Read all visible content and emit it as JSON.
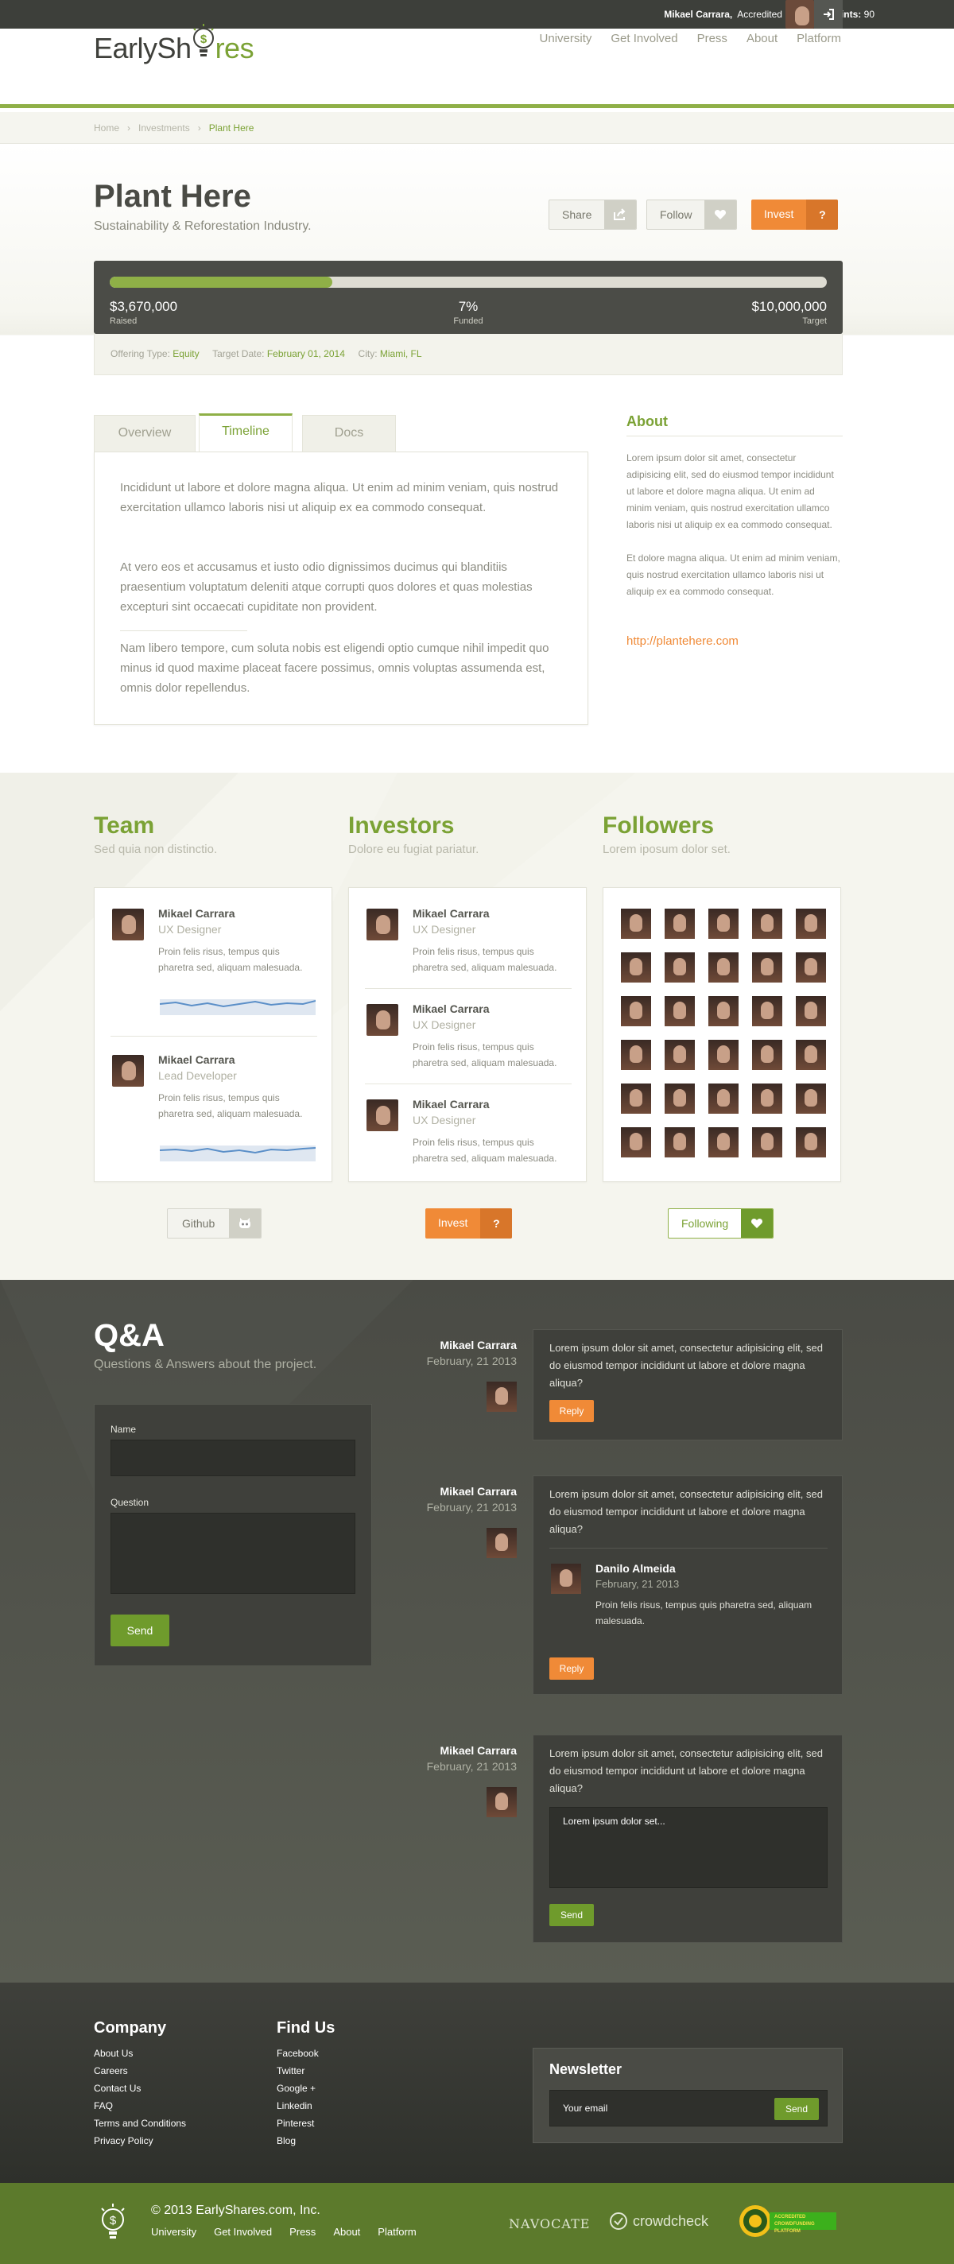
{
  "topbar": {
    "user_name": "Mikael Carrara,",
    "user_role": "Accredited Investor",
    "points_label": "Points:",
    "points_value": "90"
  },
  "header": {
    "logo_part1": "EarlySh",
    "logo_part2": "res",
    "nav": [
      "University",
      "Get Involved",
      "Press",
      "About",
      "Platform"
    ]
  },
  "breadcrumb": {
    "home": "Home",
    "sep": "›",
    "investments": "Investments",
    "current": "Plant Here"
  },
  "project": {
    "title": "Plant Here",
    "subtitle": "Sustainability & Reforestation Industry.",
    "share_label": "Share",
    "follow_label": "Follow",
    "invest_label": "Invest",
    "invest_help": "?",
    "progress": {
      "raised_value": "$3,670,000",
      "raised_label": "Raised",
      "funded_value": "7%",
      "funded_label": "Funded",
      "target_value": "$10,000,000",
      "target_label": "Target",
      "fill_fraction": 0.31
    },
    "meta": {
      "offering_label": "Offering Type:",
      "offering_value": "Equity",
      "date_label": "Target Date:",
      "date_value": "February 01, 2014",
      "city_label": "City:",
      "city_value": "Miami, FL"
    }
  },
  "tabs": [
    "Overview",
    "Timeline",
    "Docs"
  ],
  "timeline": {
    "p1": "Incididunt ut labore et dolore magna aliqua. Ut enim ad minim veniam, quis nostrud exercitation ullamco laboris nisi ut aliquip ex ea commodo consequat.",
    "p2": "At vero eos et accusamus et iusto odio dignissimos ducimus qui blanditiis praesentium voluptatum deleniti atque corrupti quos dolores et quas molestias excepturi sint occaecati cupiditate non provident.",
    "p3": "Nam libero tempore, cum soluta nobis est eligendi optio cumque nihil impedit quo minus id quod maxime placeat facere possimus, omnis voluptas assumenda est, omnis dolor repellendus."
  },
  "about": {
    "title": "About",
    "p1": "Lorem ipsum dolor sit amet, consectetur adipisicing elit, sed do eiusmod tempor incididunt ut labore et dolore magna aliqua. Ut enim ad minim veniam, quis nostrud exercitation ullamco laboris nisi ut aliquip ex ea commodo consequat.",
    "p2": "Et dolore magna aliqua. Ut enim ad minim veniam, quis nostrud exercitation ullamco laboris nisi ut aliquip ex ea commodo consequat.",
    "link": "http://plantehere.com"
  },
  "team": {
    "title": "Team",
    "subtitle": "Sed quia non distinctio.",
    "members": [
      {
        "name": "Mikael Carrara",
        "role": "UX Designer",
        "desc": "Proin felis risus, tempus quis pharetra sed, aliquam malesuada."
      },
      {
        "name": "Mikael Carrara",
        "role": "Lead Developer",
        "desc": "Proin felis risus, tempus quis pharetra sed, aliquam malesuada."
      }
    ],
    "button": "Github"
  },
  "investors": {
    "title": "Investors",
    "subtitle": "Dolore eu fugiat pariatur.",
    "members": [
      {
        "name": "Mikael Carrara",
        "role": "UX Designer",
        "desc": "Proin felis risus, tempus quis pharetra sed, aliquam malesuada."
      },
      {
        "name": "Mikael Carrara",
        "role": "UX Designer",
        "desc": "Proin felis risus, tempus quis pharetra sed, aliquam malesuada."
      },
      {
        "name": "Mikael Carrara",
        "role": "UX Designer",
        "desc": "Proin felis risus, tempus quis pharetra sed, aliquam malesuada."
      }
    ],
    "button": "Invest",
    "button_help": "?"
  },
  "followers": {
    "title": "Followers",
    "subtitle": "Lorem iposum dolor set.",
    "count": 30,
    "button": "Following"
  },
  "qa": {
    "title": "Q&A",
    "subtitle": "Questions & Answers about the project.",
    "form": {
      "name_label": "Name",
      "question_label": "Question",
      "send": "Send"
    },
    "threads": [
      {
        "name": "Mikael Carrara",
        "date": "February, 21 2013",
        "text": "Lorem ipsum dolor sit amet, consectetur adipisicing elit, sed do eiusmod tempor incididunt ut labore et dolore magna aliqua?",
        "reply": "Reply"
      },
      {
        "name": "Mikael Carrara",
        "date": "February, 21 2013",
        "text": "Lorem ipsum dolor sit amet, consectetur adipisicing elit, sed do eiusmod tempor incididunt ut labore et dolore magna aliqua?",
        "answer": {
          "name": "Danilo Almeida",
          "date": "February, 21 2013",
          "text": "Proin felis risus, tempus quis pharetra sed, aliquam malesuada."
        },
        "reply": "Reply"
      },
      {
        "name": "Mikael Carrara",
        "date": "February, 21 2013",
        "text": "Lorem ipsum dolor sit amet, consectetur adipisicing elit, sed do eiusmod tempor incididunt ut labore et dolore magna aliqua?",
        "reply_value": "Lorem ipsum dolor set...",
        "send": "Send"
      }
    ]
  },
  "footer": {
    "company_title": "Company",
    "company_links": [
      "About Us",
      "Careers",
      "Contact Us",
      "FAQ",
      "Terms and Conditions",
      "Privacy Policy"
    ],
    "find_title": "Find Us",
    "find_links": [
      "Facebook",
      "Twitter",
      "Google +",
      "Linkedin",
      "Pinterest",
      "Blog"
    ],
    "newsletter_title": "Newsletter",
    "newsletter_placeholder": "Your email",
    "newsletter_send": "Send",
    "copyright": "© 2013 EarlyShares.com, Inc.",
    "bottom_nav": [
      "University",
      "Get Involved",
      "Press",
      "About",
      "Platform"
    ],
    "partners": [
      "NAVOCATE",
      "crowdcheck",
      "ACCREDITED CROWDFUNDING PLATFORM"
    ]
  },
  "colors": {
    "brand_green": "#8fb047",
    "accent_orange": "#f08a37",
    "dark": "#4b4c47"
  }
}
